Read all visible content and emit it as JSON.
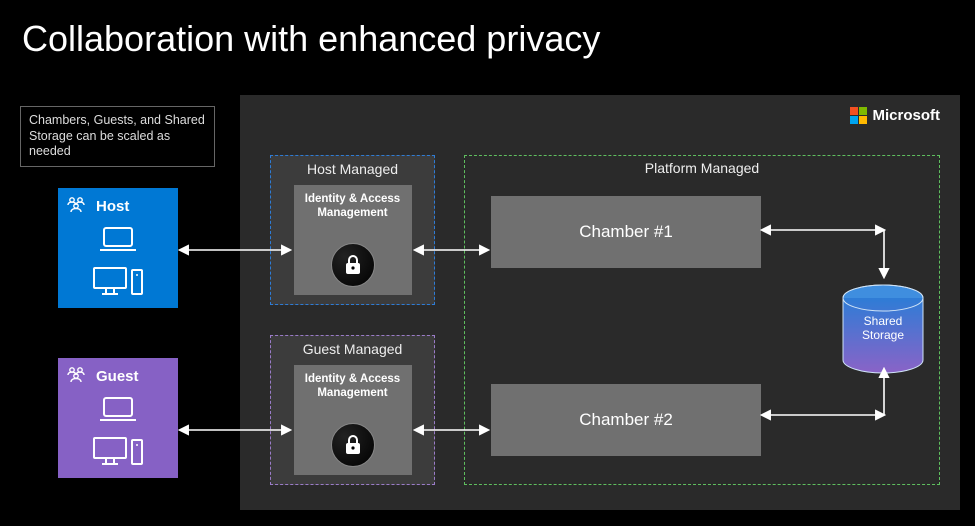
{
  "title": "Collaboration with enhanced privacy",
  "note": "Chambers, Guests, and Shared Storage can be scaled as needed",
  "brand": "Microsoft",
  "orgs": {
    "host": {
      "label": "Host"
    },
    "guest": {
      "label": "Guest"
    }
  },
  "mgmt": {
    "host": {
      "title": "Host Managed",
      "iam": "Identity & Access Management"
    },
    "guest": {
      "title": "Guest Managed",
      "iam": "Identity & Access Management"
    },
    "platform": {
      "title": "Platform Managed"
    }
  },
  "chambers": {
    "c1": "Chamber #1",
    "c2": "Chamber #2"
  },
  "storage": {
    "line1": "Shared",
    "line2": "Storage"
  },
  "icons": {
    "people": "people-icon",
    "laptop": "laptop-icon",
    "desktop": "desktop-icon",
    "lock": "lock-icon",
    "cylinder": "storage-cylinder-icon"
  },
  "colors": {
    "host": "#0078d4",
    "guest": "#8661c5",
    "host_border": "#2e7cd6",
    "guest_border": "#9b7cc9",
    "platform_border": "#5fbf5f",
    "panel": "#2a2a2a",
    "box": "#707070"
  }
}
